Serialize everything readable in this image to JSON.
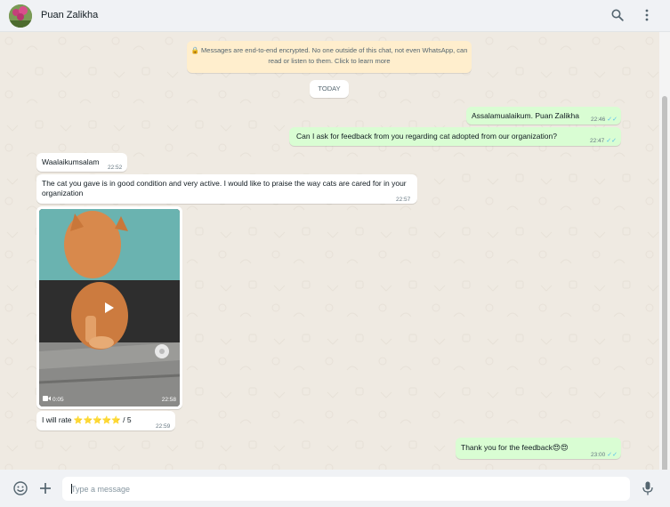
{
  "header": {
    "contact_name": "Puan Zalikha",
    "icons": [
      "avatar",
      "search-icon",
      "menu-icon"
    ]
  },
  "chat": {
    "encryption_notice": "🔒 Messages are end-to-end encrypted. No one outside of this chat, not even WhatsApp, can read or listen to them. Click to learn more",
    "date_divider": "TODAY",
    "messages": [
      {
        "direction": "out",
        "text": "Assalamualaikum. Puan Zalikha",
        "time": "22:46"
      },
      {
        "direction": "out",
        "text": "Can I ask for feedback from you regarding cat adopted from our organization?",
        "time": "22:47"
      },
      {
        "direction": "in",
        "text": "Waalaikumsalam",
        "time": "22:52"
      },
      {
        "direction": "in",
        "text": "The cat you gave is in good condition and very active. I would like to praise the way cats are cared for in your organization",
        "time": "22:57"
      },
      {
        "direction": "in",
        "type": "video",
        "duration": "0:05",
        "time": "22:58"
      },
      {
        "direction": "in",
        "text": "I will rate ⭐⭐⭐⭐⭐ / 5",
        "time": "22:59"
      },
      {
        "direction": "out",
        "text": "Thank you for the feedback😍😍",
        "time": "23:00"
      }
    ]
  },
  "footer": {
    "input_placeholder": "Type a message",
    "icons": [
      "emoji-icon",
      "attach-icon",
      "mic-icon"
    ]
  },
  "colors": {
    "outgoing_bubble": "#d9fdd3",
    "incoming_bubble": "#ffffff",
    "read_ticks": "#53bdeb",
    "chat_background": "#efeae2",
    "encryption_banner": "#ffeecd"
  }
}
